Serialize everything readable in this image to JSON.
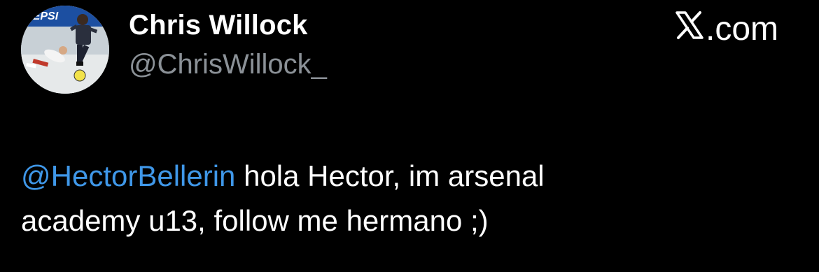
{
  "colors": {
    "background": "#000000",
    "text": "#ffffff",
    "handle": "#8b9197",
    "mention": "#3f97e8"
  },
  "author": {
    "avatar_icon": "profile-photo-footballers",
    "avatar_lettering": "PEPSI",
    "display_name": "Chris Willock",
    "handle": "@ChrisWillock_"
  },
  "site": {
    "logo_icon": "x-logo-icon",
    "domain_suffix": ".com"
  },
  "tweet": {
    "mention": "@HectorBellerin",
    "text_line1": " hola Hector, im arsenal",
    "text_line2": "academy u13, follow me hermano ;)"
  }
}
